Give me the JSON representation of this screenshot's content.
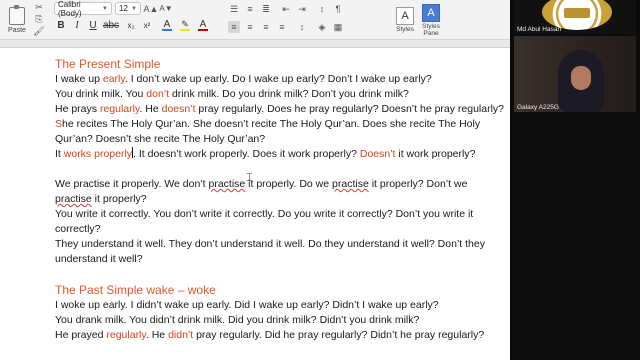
{
  "ribbon": {
    "paste_label": "Paste",
    "font_name": "Calibri (Body)",
    "font_size": "12",
    "font_color": "#c00000",
    "styles_label": "Styles",
    "styles_pane_label": "Styles Pane"
  },
  "document": {
    "section1": {
      "heading": "The Present Simple",
      "line1": [
        "I wake up ",
        "early",
        ". I don’t wake up early. Do I wake up early? Don’t I wake up early?"
      ],
      "line2": [
        "You drink milk. You ",
        "don’t",
        " drink milk. Do you drink milk? Don’t you drink milk?"
      ],
      "line3": [
        "He prays ",
        "regularly",
        ". He ",
        "doesn’t",
        " pray regularly. Does he pray regularly? Doesn’t he pray regularly?"
      ],
      "line4": [
        "S",
        "he",
        " recites The Holy Qur’an. She doesn’t recite The Holy Qur’an. Does she recite The Holy Qur’an? Doesn’t she recite The Holy Qur’an?"
      ],
      "line5": [
        "It ",
        "works properly",
        ". It doesn’t work properly. Does it work properly? ",
        "Doesn’t",
        " it work properly?"
      ]
    },
    "section2": {
      "line1": [
        "We practise it properly. We don’t ",
        "practise",
        " it properly. Do we ",
        "practise",
        " it properly? Don’t we ",
        "practise",
        " it properly?"
      ],
      "line2": "You write it correctly. You don’t write it correctly. Do you write it correctly? Don’t you write it correctly?",
      "line3": "They understand it well. They don’t understand it well. Do they understand it well? Don’t they understand it well?"
    },
    "section3": {
      "heading": "The Past Simple wake – woke",
      "line1": "I woke up early. I didn’t wake up early. Did I wake up early? Didn’t I wake up early?",
      "line2": "You drank milk. You didn’t drink milk. Did you drink milk? Didn’t you drink milk?",
      "line3": [
        "He prayed ",
        "regularly",
        ". He ",
        "didn’t",
        " pray regularly. Did he pray regularly? Didn’t he pray regularly?"
      ]
    }
  },
  "participants": [
    {
      "name": "Md Abul Hasan"
    },
    {
      "name": "Galaxy A225G"
    }
  ],
  "colors": {
    "heading": "#e0592a",
    "highlight_text": "#d0461f",
    "spellcheck": "#d04040"
  }
}
